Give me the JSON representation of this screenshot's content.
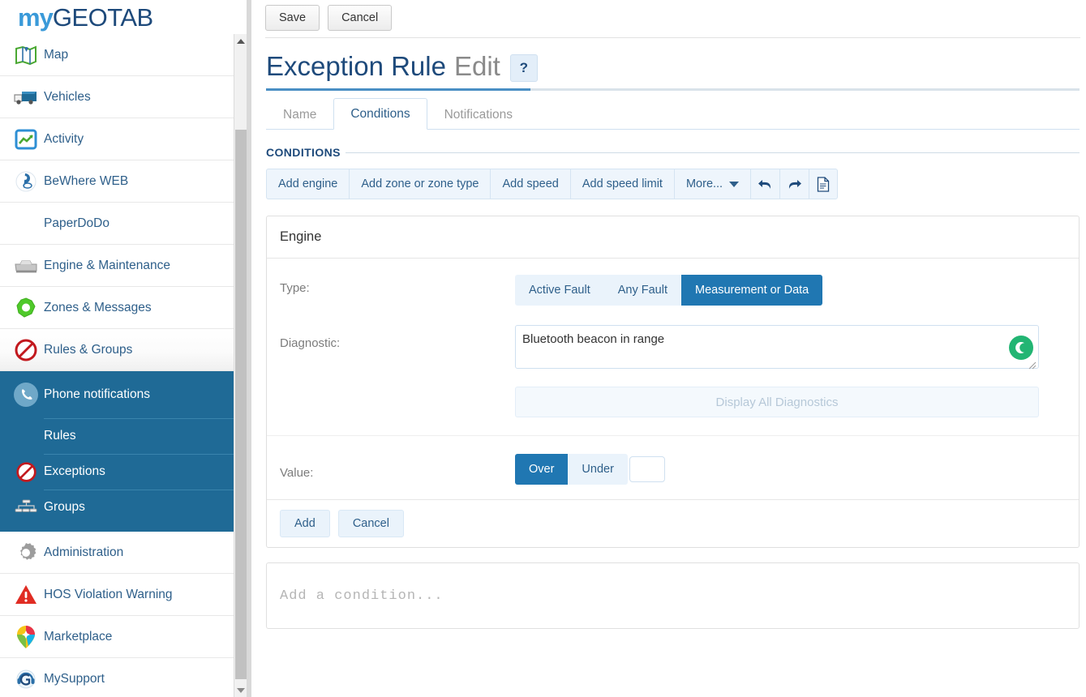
{
  "brand": {
    "prefix": "my",
    "suffix": "GEOTAB"
  },
  "sidebar": {
    "items": [
      {
        "label": "Map",
        "icon": "map-icon"
      },
      {
        "label": "Vehicles",
        "icon": "truck-icon"
      },
      {
        "label": "Activity",
        "icon": "activity-chart-icon"
      },
      {
        "label": "BeWhere WEB",
        "icon": "bewhere-pin-icon"
      },
      {
        "label": "PaperDoDo",
        "icon": "none"
      },
      {
        "label": "Engine & Maintenance",
        "icon": "engine-icon"
      },
      {
        "label": "Zones & Messages",
        "icon": "zone-gear-icon"
      },
      {
        "label": "Rules & Groups",
        "icon": "no-entry-icon"
      }
    ],
    "active_group": [
      {
        "label": "Phone notifications",
        "icon": "phone-icon"
      },
      {
        "label": "Rules",
        "icon": "none"
      },
      {
        "label": "Exceptions",
        "icon": "no-entry-icon"
      },
      {
        "label": "Groups",
        "icon": "org-tree-icon"
      }
    ],
    "items_after": [
      {
        "label": "Administration",
        "icon": "gear-icon"
      },
      {
        "label": "HOS Violation Warning",
        "icon": "warning-triangle-icon"
      },
      {
        "label": "Marketplace",
        "icon": "marketplace-pin-icon"
      },
      {
        "label": "MySupport",
        "icon": "support-headset-icon"
      }
    ],
    "scrollbar": {
      "up": "scroll-up-arrow",
      "down": "scroll-down-arrow"
    }
  },
  "toolbar": {
    "save_label": "Save",
    "cancel_label": "Cancel"
  },
  "header": {
    "title": "Exception Rule",
    "subtitle": "Edit",
    "help_label": "?"
  },
  "tabs": [
    {
      "label": "Name",
      "active": false
    },
    {
      "label": "Conditions",
      "active": true
    },
    {
      "label": "Notifications",
      "active": false
    }
  ],
  "conditions": {
    "section_title": "CONDITIONS",
    "buttons": [
      "Add engine",
      "Add zone or zone type",
      "Add speed",
      "Add speed limit",
      "More..."
    ],
    "icons": [
      "undo-icon",
      "redo-icon",
      "document-icon"
    ],
    "panel": {
      "title": "Engine",
      "type_label": "Type:",
      "type_options": [
        {
          "label": "Active Fault",
          "selected": false
        },
        {
          "label": "Any Fault",
          "selected": false
        },
        {
          "label": "Measurement or Data",
          "selected": true
        }
      ],
      "diagnostic_label": "Diagnostic:",
      "diagnostic_value": "Bluetooth beacon in range",
      "diagnostic_spinner": "loading-spinner-icon",
      "display_all_label": "Display All Diagnostics",
      "value_label": "Value:",
      "value_options": [
        {
          "label": "Over",
          "selected": true
        },
        {
          "label": "Under",
          "selected": false
        }
      ],
      "value_number": "",
      "add_label": "Add",
      "cancel_label": "Cancel"
    },
    "add_condition_placeholder": "Add a condition..."
  },
  "colors": {
    "brand_blue": "#1e4a7b",
    "brand_light_blue": "#3a9ad9",
    "accent": "#2077b2",
    "sidebar_active": "#1f6a96",
    "spinner_green": "#22b573"
  }
}
